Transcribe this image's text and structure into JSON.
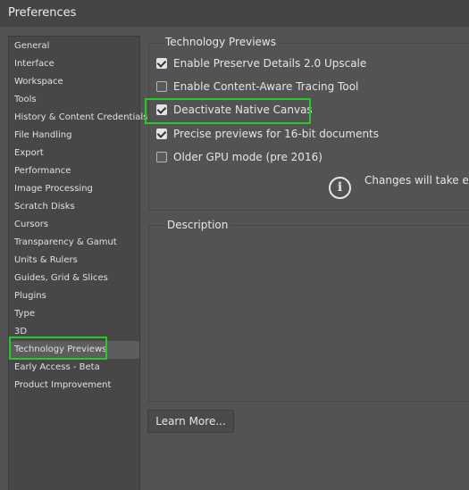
{
  "window": {
    "title": "Preferences"
  },
  "sidebar": {
    "items": [
      {
        "label": "General"
      },
      {
        "label": "Interface"
      },
      {
        "label": "Workspace"
      },
      {
        "label": "Tools"
      },
      {
        "label": "History & Content Credentials"
      },
      {
        "label": "File Handling"
      },
      {
        "label": "Export"
      },
      {
        "label": "Performance"
      },
      {
        "label": "Image Processing"
      },
      {
        "label": "Scratch Disks"
      },
      {
        "label": "Cursors"
      },
      {
        "label": "Transparency & Gamut"
      },
      {
        "label": "Units & Rulers"
      },
      {
        "label": "Guides, Grid & Slices"
      },
      {
        "label": "Plugins"
      },
      {
        "label": "Type"
      },
      {
        "label": "3D"
      },
      {
        "label": "Technology Previews",
        "selected": true
      },
      {
        "label": "Early Access - Beta"
      },
      {
        "label": "Product Improvement"
      }
    ]
  },
  "tech_previews": {
    "group_title": "Technology Previews",
    "options": [
      {
        "label": "Enable Preserve Details 2.0 Upscale",
        "checked": true
      },
      {
        "label": "Enable Content-Aware Tracing Tool",
        "checked": false
      },
      {
        "label": "Deactivate Native Canvas",
        "checked": true
      },
      {
        "label": "Precise previews for 16-bit documents",
        "checked": true
      },
      {
        "label": "Older GPU mode (pre 2016)",
        "checked": false
      }
    ],
    "info_text": "Changes will take effe"
  },
  "description": {
    "group_title": "Description"
  },
  "buttons": {
    "learn_more": "Learn More..."
  },
  "colors": {
    "highlight": "#22cc22",
    "background": "#535353"
  }
}
